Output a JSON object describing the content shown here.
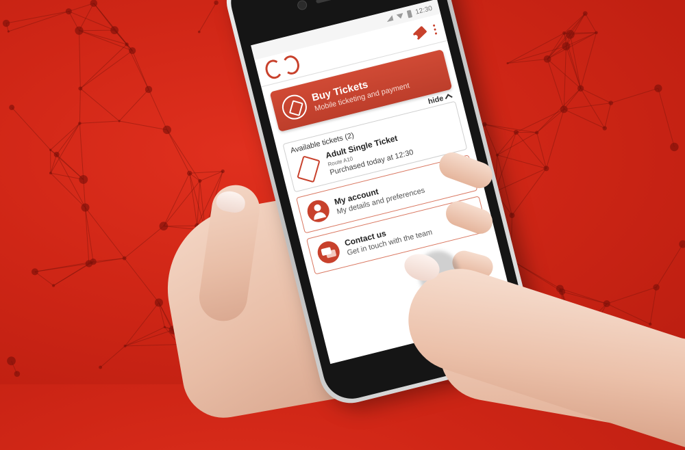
{
  "status_bar": {
    "time": "12:30"
  },
  "header": {
    "logo": "CC"
  },
  "buy_tickets": {
    "title": "Buy Tickets",
    "subtitle": "Mobile ticketing and payment",
    "hide_label": "hide"
  },
  "tickets": {
    "label": "Available tickets (2)",
    "items": [
      {
        "name": "Adult Single Ticket",
        "route": "Route A10",
        "purchased": "Purchased today at 12:30"
      }
    ]
  },
  "menu": [
    {
      "title": "My account",
      "subtitle": "My details and preferences",
      "icon": "person-icon"
    },
    {
      "title": "Contact us",
      "subtitle": "Get in touch with the team",
      "icon": "chat-bubble-icon"
    }
  ],
  "colors": {
    "brand": "#c8412c",
    "background": "#d12a18"
  }
}
